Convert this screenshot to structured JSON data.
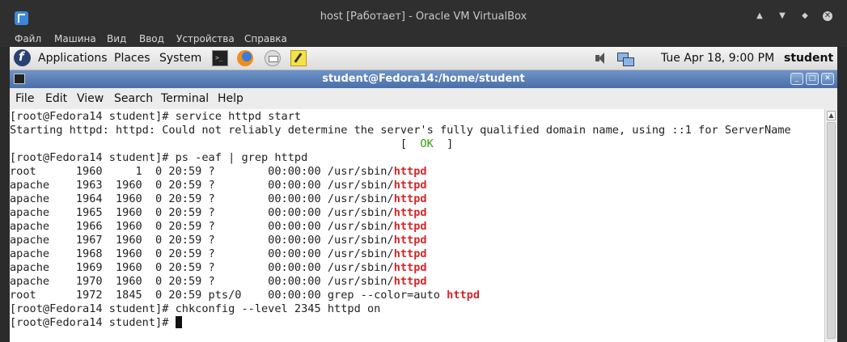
{
  "vbox": {
    "title": "host [Работает] - Oracle VM VirtualBox",
    "menu": [
      "Файл",
      "Машина",
      "Вид",
      "Ввод",
      "Устройства",
      "Справка"
    ]
  },
  "gnome_panel": {
    "menus": [
      "Applications",
      "Places",
      "System"
    ],
    "clock": "Tue Apr 18,  9:00 PM",
    "user": "student",
    "launchers": [
      "terminal-icon",
      "firefox-icon",
      "mail-icon",
      "notes-icon"
    ],
    "tray": [
      "speaker-icon",
      "network-icon"
    ]
  },
  "terminal": {
    "title": "student@Fedora14:/home/student",
    "menu": [
      "File",
      "Edit",
      "View",
      "Search",
      "Terminal",
      "Help"
    ],
    "lines": [
      {
        "text": "[root@Fedora14 student]# service httpd start"
      },
      {
        "text": "Starting httpd: httpd: Could not reliably determine the server's fully qualified domain name, using ::1 for ServerName"
      },
      {
        "pre": "                                                           [  ",
        "ok": "OK",
        "post": "  ]"
      },
      {
        "text": "[root@Fedora14 student]# ps -eaf | grep httpd"
      },
      {
        "pre": "root      1960     1  0 20:59 ?        00:00:00 /usr/sbin/",
        "hl": "httpd"
      },
      {
        "pre": "apache    1963  1960  0 20:59 ?        00:00:00 /usr/sbin/",
        "hl": "httpd"
      },
      {
        "pre": "apache    1964  1960  0 20:59 ?        00:00:00 /usr/sbin/",
        "hl": "httpd"
      },
      {
        "pre": "apache    1965  1960  0 20:59 ?        00:00:00 /usr/sbin/",
        "hl": "httpd"
      },
      {
        "pre": "apache    1966  1960  0 20:59 ?        00:00:00 /usr/sbin/",
        "hl": "httpd"
      },
      {
        "pre": "apache    1967  1960  0 20:59 ?        00:00:00 /usr/sbin/",
        "hl": "httpd"
      },
      {
        "pre": "apache    1968  1960  0 20:59 ?        00:00:00 /usr/sbin/",
        "hl": "httpd"
      },
      {
        "pre": "apache    1969  1960  0 20:59 ?        00:00:00 /usr/sbin/",
        "hl": "httpd"
      },
      {
        "pre": "apache    1970  1960  0 20:59 ?        00:00:00 /usr/sbin/",
        "hl": "httpd"
      },
      {
        "pre": "root      1972  1845  0 20:59 pts/0    00:00:00 grep --color=auto ",
        "hl": "httpd"
      },
      {
        "text": "[root@Fedora14 student]# chkconfig --level 2345 httpd on"
      },
      {
        "pre": "[root@Fedora14 student]# ",
        "cursor": true
      }
    ]
  },
  "colors": {
    "highlight": "#d3272a",
    "ok": "#3a9a12",
    "titlebar": "#4a6fa8"
  }
}
